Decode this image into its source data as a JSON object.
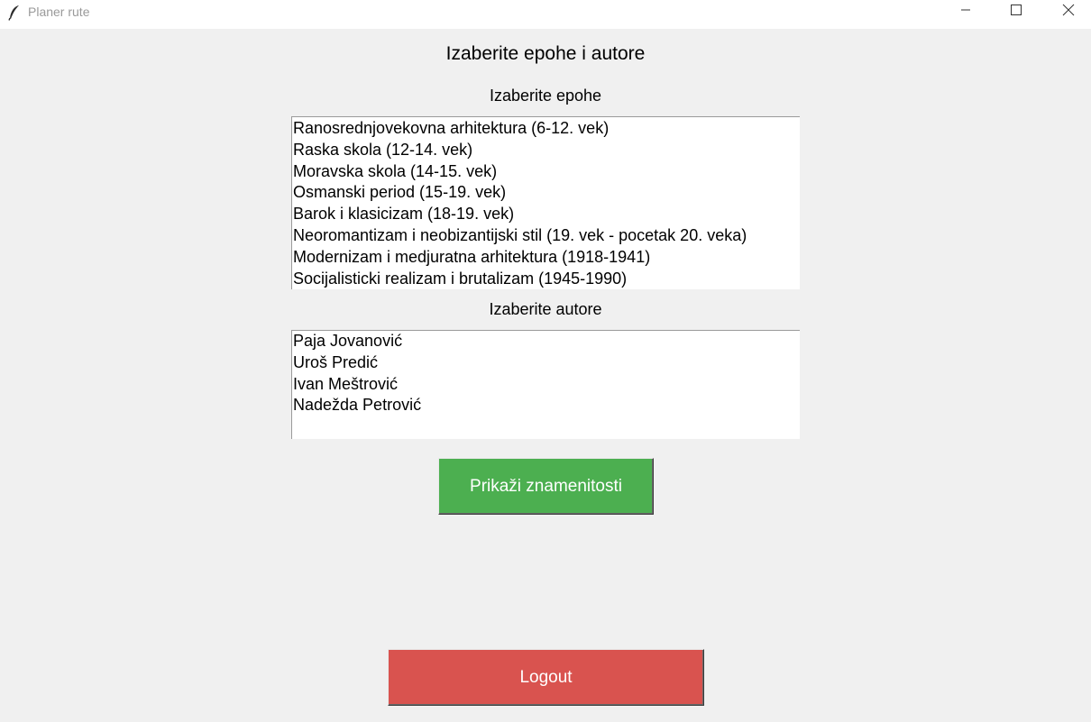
{
  "window": {
    "title": "Planer rute",
    "icon": "feather-icon",
    "controls": [
      "minimize-icon",
      "maximize-icon",
      "close-icon"
    ]
  },
  "heading": "Izaberite epohe i autore",
  "epochs": {
    "label": "Izaberite epohe",
    "items": [
      "Ranosrednjovekovna arhitektura (6-12. vek)",
      "Raska skola (12-14. vek)",
      "Moravska skola (14-15. vek)",
      "Osmanski period (15-19. vek)",
      "Barok i klasicizam (18-19. vek)",
      "Neoromantizam i neobizantijski stil (19. vek - pocetak 20. veka)",
      "Modernizam i medjuratna arhitektura (1918-1941)",
      "Socijalisticki realizam i brutalizam (1945-1990)"
    ]
  },
  "authors": {
    "label": "Izaberite autore",
    "items": [
      "Paja Jovanović",
      "Uroš Predić",
      "Ivan Meštrović",
      "Nadežda Petrović"
    ]
  },
  "buttons": {
    "show_label": "Prikaži znamenitosti",
    "logout_label": "Logout"
  },
  "colors": {
    "show_button": "#4caf50",
    "logout_button": "#d9534f",
    "background": "#f0f0f0"
  }
}
